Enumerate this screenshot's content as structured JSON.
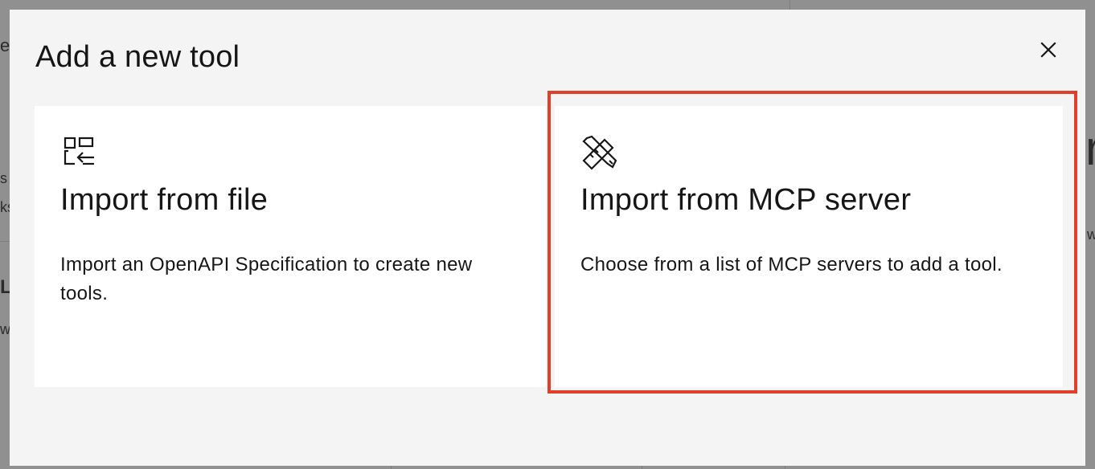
{
  "modal": {
    "title": "Add a new tool",
    "close_label": "Close"
  },
  "cards": [
    {
      "icon": "import-file-icon",
      "title": "Import from file",
      "description": "Import an OpenAPI Specification to create new tools."
    },
    {
      "icon": "tools-icon",
      "title": "Import from MCP server",
      "description": "Choose from a list of MCP servers to add a tool."
    }
  ],
  "background": {
    "fragments": [
      "e",
      "s",
      "ks",
      "L",
      "w",
      "r",
      "w"
    ]
  },
  "colors": {
    "overlay": "#8d8d8d",
    "modal_bg": "#f4f4f4",
    "card_bg": "#ffffff",
    "text": "#161616",
    "highlight": "#e0402a"
  }
}
